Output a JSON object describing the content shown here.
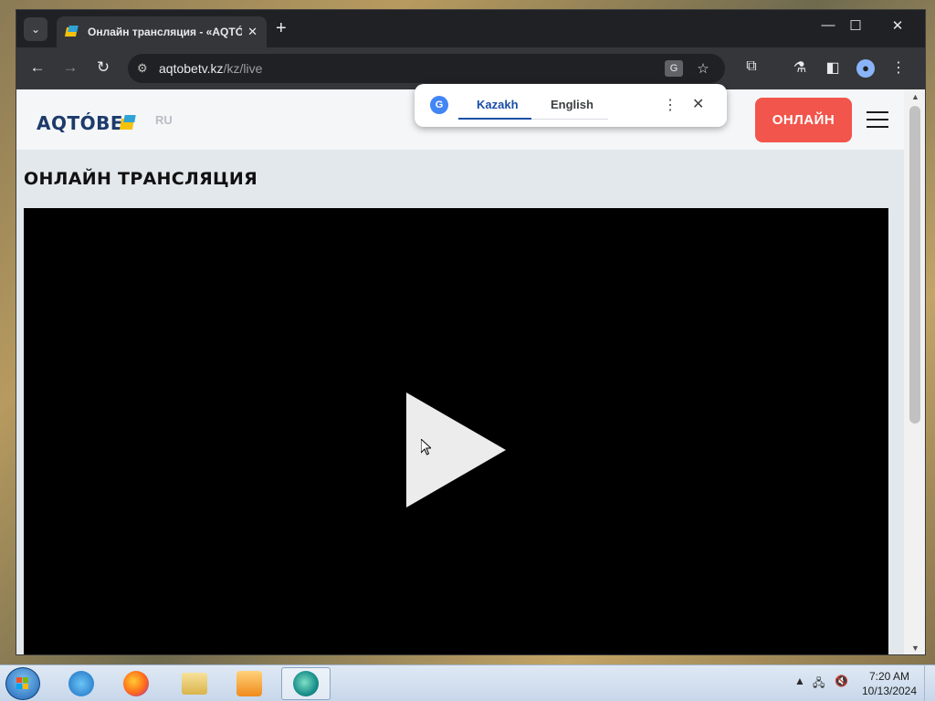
{
  "browser": {
    "tab_title": "Онлайн трансляция - «AQTÓBE",
    "tab_close": "✕",
    "new_tab": "+",
    "window_controls": {
      "minimize": "—",
      "maximize": "☐",
      "close": "✕"
    },
    "url_host": "aqtobetv.kz",
    "url_path": "/kz/live",
    "icons": {
      "back": "←",
      "forward": "→",
      "reload": "↻",
      "site_info": "⚙",
      "translate": "G",
      "bookmark": "☆",
      "extensions": "⧉",
      "labs": "⚗",
      "side_panel": "◧",
      "profile": "●",
      "menu": "⋮",
      "tab_search": "⌄"
    }
  },
  "translate_popup": {
    "badge": "G",
    "lang_active": "Kazakh",
    "lang_other": "English",
    "more": "⋮",
    "close": "✕"
  },
  "site": {
    "logo_text": "AQTÓBE",
    "lang_switch": "RU",
    "live_button": "ОНЛАЙН",
    "page_title": "ОНЛАЙН ТРАНСЛЯЦИЯ"
  },
  "scrollbar": {
    "up": "▲",
    "down": "▼"
  },
  "taskbar": {
    "clock_time": "7:20 AM",
    "clock_date": "10/13/2024",
    "tray_expand": "▲",
    "tray_network": "🖧",
    "tray_volume": "🔇"
  },
  "colors": {
    "accent_live": "#f2554b",
    "brand_navy": "#1d3a6b",
    "brand_yellow": "#f4c20d",
    "brand_blue": "#2fa3d6",
    "translate_blue": "#1a4fa6"
  }
}
